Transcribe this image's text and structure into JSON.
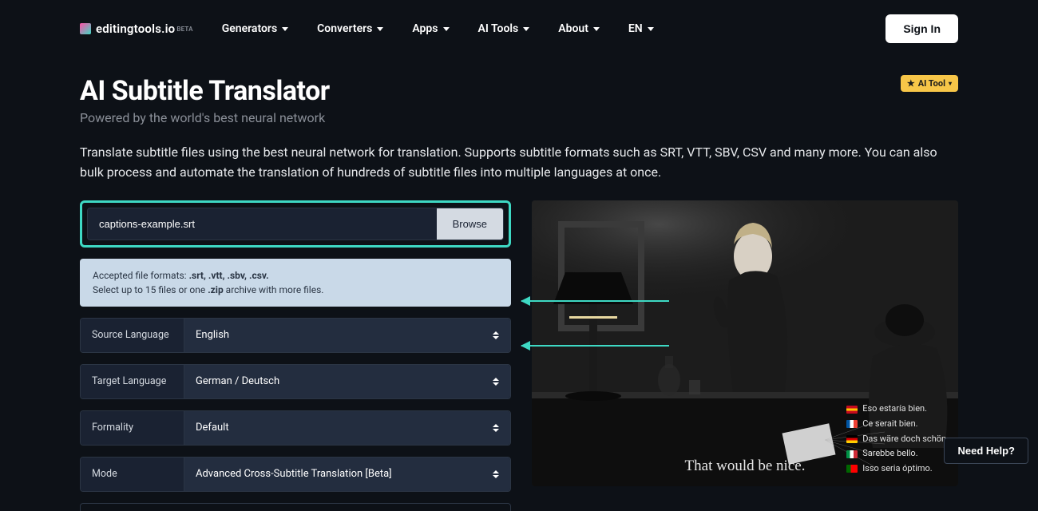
{
  "logo": {
    "text": "editingtools.io",
    "sup": "BETA"
  },
  "nav": {
    "generators": "Generators",
    "converters": "Converters",
    "apps": "Apps",
    "aitools": "AI Tools",
    "about": "About",
    "lang": "EN"
  },
  "signin": "Sign In",
  "title": "AI Subtitle Translator",
  "subtitle": "Powered by the world's best neural network",
  "ai_badge": "AI Tool",
  "description": "Translate subtitle files using the best neural network for translation. Supports subtitle formats such as SRT, VTT, SBV, CSV and many more. You can also bulk process and automate the translation of hundreds of subtitle files into multiple languages at once.",
  "upload": {
    "filename": "captions-example.srt",
    "browse": "Browse"
  },
  "hint": {
    "line1_prefix": "Accepted file formats: ",
    "line1_formats": ".srt, .vtt, .sbv, .csv.",
    "line2_prefix": "Select up to 15 files or one ",
    "line2_bold": ".zip",
    "line2_suffix": " archive with more files."
  },
  "fields": {
    "source": {
      "label": "Source Language",
      "value": "English"
    },
    "target": {
      "label": "Target Language",
      "value": "German / Deutsch"
    },
    "formality": {
      "label": "Formality",
      "value": "Default"
    },
    "mode": {
      "label": "Mode",
      "value": "Advanced Cross-Subtitle Translation [Beta]"
    }
  },
  "caption": "That would be nice.",
  "translations": {
    "es": "Eso estaría bien.",
    "fr": "Ce serait bien.",
    "de": "Das wäre doch schön.",
    "it": "Sarebbe bello.",
    "pt": "Isso seria óptimo."
  },
  "help": "Need Help?"
}
